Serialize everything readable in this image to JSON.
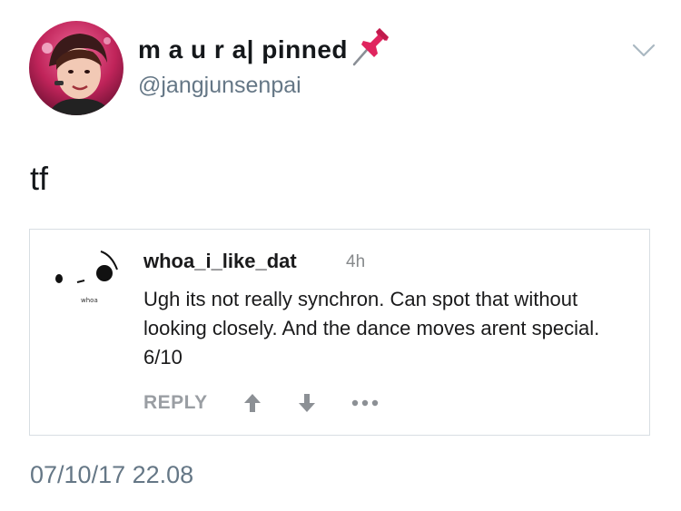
{
  "tweet": {
    "author": {
      "display_name": "m a u r a| pinned",
      "handle": "@jangjunsenpai",
      "avatar_icon": "profile-photo",
      "pin_icon": "pushpin-icon"
    },
    "menu_icon": "chevron-down-icon",
    "text": "tf",
    "timestamp": "07/10/17 22.08"
  },
  "quoted_comment": {
    "username": "whoa_i_like_dat",
    "time_ago": "4h",
    "avatar_caption": "whoa",
    "body": "Ugh its not really synchron. Can spot that without looking closely. And the dance moves arent special. 6/10",
    "actions": {
      "reply_label": "REPLY",
      "upvote_icon": "upvote-arrow-icon",
      "downvote_icon": "downvote-arrow-icon",
      "more_icon": "more-options-icon"
    }
  },
  "colors": {
    "text_primary": "#14171a",
    "text_secondary": "#657786",
    "card_border": "#d8dee3",
    "pin_red": "#e0245e",
    "action_gray": "#9a9ea3"
  }
}
